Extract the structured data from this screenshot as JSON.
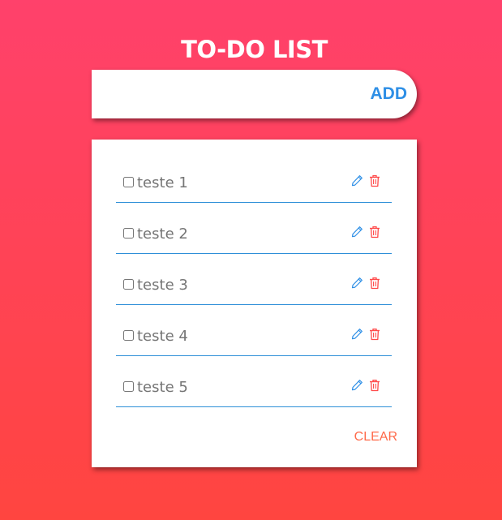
{
  "app": {
    "title": "TO-DO LIST"
  },
  "input": {
    "value": "",
    "placeholder": "",
    "add_label": "ADD"
  },
  "todos": [
    {
      "text": "teste 1",
      "checked": false
    },
    {
      "text": "teste 2",
      "checked": false
    },
    {
      "text": "teste 3",
      "checked": false
    },
    {
      "text": "teste 4",
      "checked": false
    },
    {
      "text": "teste 5",
      "checked": false
    }
  ],
  "actions": {
    "clear_label": "CLEAR",
    "edit_icon": "pencil-icon",
    "delete_icon": "trash-icon"
  },
  "colors": {
    "bg_top": "#ff416b",
    "bg_bottom": "#ff4540",
    "accent_blue": "#2e8fe6",
    "delete_red": "#ff4a4a",
    "clear_orange": "#ff6a4a",
    "item_text": "#757575"
  }
}
